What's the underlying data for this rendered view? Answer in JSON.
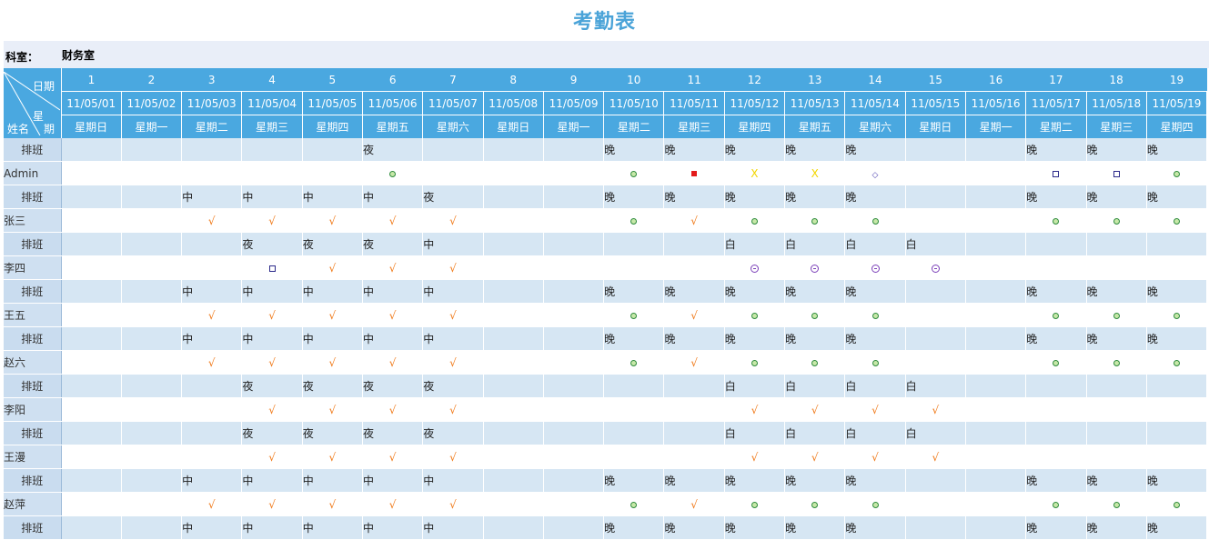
{
  "title": "考勤表",
  "department": {
    "label": "科室：",
    "value": "财务室"
  },
  "corner": {
    "date": "日期",
    "xing": "星",
    "qi": "期",
    "name": "姓名"
  },
  "days": [
    "1",
    "2",
    "3",
    "4",
    "5",
    "6",
    "7",
    "8",
    "9",
    "10",
    "11",
    "12",
    "13",
    "14",
    "15",
    "16",
    "17",
    "18",
    "19"
  ],
  "dates": [
    "11/05/01",
    "11/05/02",
    "11/05/03",
    "11/05/04",
    "11/05/05",
    "11/05/06",
    "11/05/07",
    "11/05/08",
    "11/05/09",
    "11/05/10",
    "11/05/11",
    "11/05/12",
    "11/05/13",
    "11/05/14",
    "11/05/15",
    "11/05/16",
    "11/05/17",
    "11/05/18",
    "11/05/19"
  ],
  "weekdays": [
    "星期日",
    "星期一",
    "星期二",
    "星期三",
    "星期四",
    "星期五",
    "星期六",
    "星期日",
    "星期一",
    "星期二",
    "星期三",
    "星期四",
    "星期五",
    "星期六",
    "星期日",
    "星期一",
    "星期二",
    "星期三",
    "星期四"
  ],
  "schedule_label": "排班",
  "employees": [
    {
      "name": "Admin",
      "schedule": [
        "",
        "",
        "",
        "",
        "",
        "夜",
        "",
        "",
        "",
        "晚",
        "晚",
        "晚",
        "晚",
        "晚",
        "",
        "",
        "晚",
        "晚",
        "晚"
      ],
      "attendance": [
        "",
        "",
        "",
        "",
        "",
        "dot",
        "",
        "",
        "",
        "dot",
        "red",
        "x",
        "x",
        "diamond",
        "",
        "",
        "square",
        "square",
        "dot"
      ]
    },
    {
      "name": "张三",
      "schedule": [
        "",
        "",
        "中",
        "中",
        "中",
        "中",
        "夜",
        "",
        "",
        "晚",
        "晚",
        "晚",
        "晚",
        "晚",
        "",
        "",
        "晚",
        "晚",
        "晚"
      ],
      "attendance": [
        "",
        "",
        "check",
        "check",
        "check",
        "check",
        "check",
        "",
        "",
        "dot",
        "check",
        "dot",
        "dot",
        "dot",
        "",
        "",
        "dot",
        "dot",
        "dot"
      ]
    },
    {
      "name": "李四",
      "schedule": [
        "",
        "",
        "",
        "夜",
        "夜",
        "夜",
        "中",
        "",
        "",
        "",
        "",
        "白",
        "白",
        "白",
        "白",
        "",
        "",
        "",
        ""
      ],
      "attendance": [
        "",
        "",
        "",
        "square",
        "check",
        "check",
        "check",
        "",
        "",
        "",
        "",
        "ring",
        "ring",
        "ring",
        "ring",
        "",
        "",
        "",
        ""
      ]
    },
    {
      "name": "王五",
      "schedule": [
        "",
        "",
        "中",
        "中",
        "中",
        "中",
        "中",
        "",
        "",
        "晚",
        "晚",
        "晚",
        "晚",
        "晚",
        "",
        "",
        "晚",
        "晚",
        "晚"
      ],
      "attendance": [
        "",
        "",
        "check",
        "check",
        "check",
        "check",
        "check",
        "",
        "",
        "dot",
        "check",
        "dot",
        "dot",
        "dot",
        "",
        "",
        "dot",
        "dot",
        "dot"
      ]
    },
    {
      "name": "赵六",
      "schedule": [
        "",
        "",
        "中",
        "中",
        "中",
        "中",
        "中",
        "",
        "",
        "晚",
        "晚",
        "晚",
        "晚",
        "晚",
        "",
        "",
        "晚",
        "晚",
        "晚"
      ],
      "attendance": [
        "",
        "",
        "check",
        "check",
        "check",
        "check",
        "check",
        "",
        "",
        "dot",
        "check",
        "dot",
        "dot",
        "dot",
        "",
        "",
        "dot",
        "dot",
        "dot"
      ]
    },
    {
      "name": "李阳",
      "schedule": [
        "",
        "",
        "",
        "夜",
        "夜",
        "夜",
        "夜",
        "",
        "",
        "",
        "",
        "白",
        "白",
        "白",
        "白",
        "",
        "",
        "",
        ""
      ],
      "attendance": [
        "",
        "",
        "",
        "check",
        "check",
        "check",
        "check",
        "",
        "",
        "",
        "",
        "check",
        "check",
        "check",
        "check",
        "",
        "",
        "",
        ""
      ]
    },
    {
      "name": "王漫",
      "schedule": [
        "",
        "",
        "",
        "夜",
        "夜",
        "夜",
        "夜",
        "",
        "",
        "",
        "",
        "白",
        "白",
        "白",
        "白",
        "",
        "",
        "",
        ""
      ],
      "attendance": [
        "",
        "",
        "",
        "check",
        "check",
        "check",
        "check",
        "",
        "",
        "",
        "",
        "check",
        "check",
        "check",
        "check",
        "",
        "",
        "",
        ""
      ]
    },
    {
      "name": "赵萍",
      "schedule": [
        "",
        "",
        "中",
        "中",
        "中",
        "中",
        "中",
        "",
        "",
        "晚",
        "晚",
        "晚",
        "晚",
        "晚",
        "",
        "",
        "晚",
        "晚",
        "晚"
      ],
      "attendance": [
        "",
        "",
        "check",
        "check",
        "check",
        "check",
        "check",
        "",
        "",
        "dot",
        "check",
        "dot",
        "dot",
        "dot",
        "",
        "",
        "dot",
        "dot",
        "dot"
      ]
    }
  ],
  "trailing_schedule": [
    "",
    "",
    "中",
    "中",
    "中",
    "中",
    "中",
    "",
    "",
    "晚",
    "晚",
    "晚",
    "晚",
    "晚",
    "",
    "",
    "晚",
    "晚",
    "晚"
  ],
  "marks": {
    "check": "√",
    "x": "X",
    "diamond": "◇"
  }
}
